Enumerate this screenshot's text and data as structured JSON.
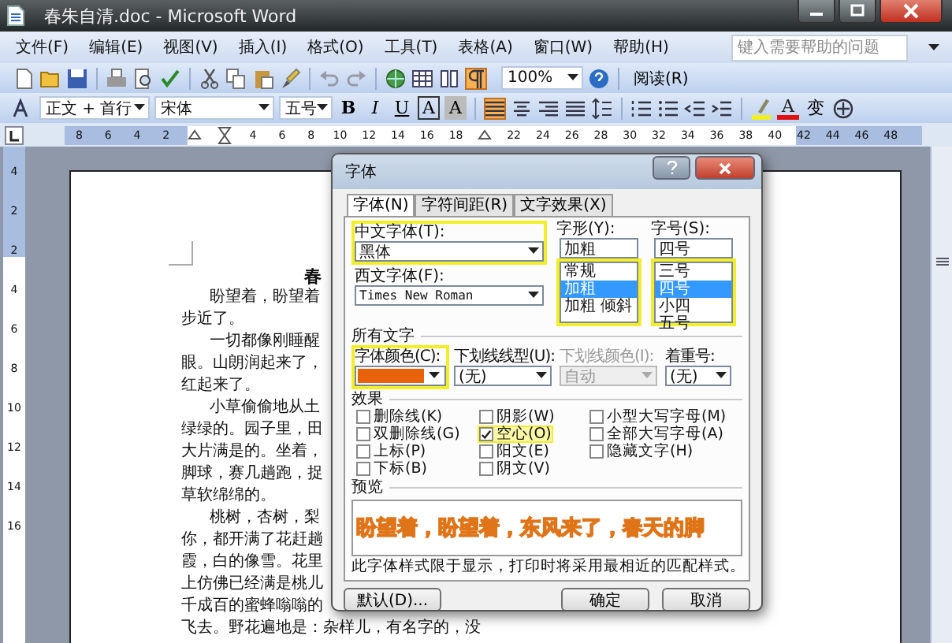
{
  "window": {
    "title": "春朱自清.doc - Microsoft Word"
  },
  "menu_bar": {
    "items": [
      "文件(F)",
      "编辑(E)",
      "视图(V)",
      "插入(I)",
      "格式(O)",
      "工具(T)",
      "表格(A)",
      "窗口(W)",
      "帮助(H)"
    ],
    "help_search": {
      "placeholder": "键入需要帮助的问题"
    }
  },
  "standard_toolbar": {
    "formatting_marks": {
      "on": true
    },
    "zoom": "100%",
    "read_button": "阅读(R)"
  },
  "formatting_toolbar": {
    "style": "正文 + 首行",
    "font": "宋体",
    "size": "五号",
    "format_buttons": [
      {
        "label": "B",
        "kind": "bold"
      },
      {
        "label": "I",
        "kind": "italic"
      },
      {
        "label": "U",
        "kind": "underline"
      },
      {
        "label": "A",
        "kind": "border"
      },
      {
        "label": "A",
        "kind": "shading"
      }
    ],
    "alignment": [
      {
        "kind": "justify",
        "selected": true
      },
      {
        "kind": "center",
        "selected": false
      },
      {
        "kind": "right",
        "selected": false
      },
      {
        "kind": "distributed",
        "selected": false
      }
    ],
    "font_color": {
      "label": "A",
      "color": "#e01010"
    },
    "phonetic_guide": "变"
  },
  "ruler": {
    "marks": [
      {
        "kind": "number",
        "label": "8"
      },
      {
        "kind": "number",
        "label": "6"
      },
      {
        "kind": "number",
        "label": "4"
      },
      {
        "kind": "number",
        "label": "2"
      },
      {
        "kind": "hanging_indent"
      },
      {
        "kind": "first_line_indent"
      },
      {
        "kind": "number",
        "label": "4"
      },
      {
        "kind": "number",
        "label": "6"
      },
      {
        "kind": "number",
        "label": "8"
      },
      {
        "kind": "number",
        "label": "10"
      },
      {
        "kind": "number",
        "label": "12"
      },
      {
        "kind": "number",
        "label": "14"
      },
      {
        "kind": "number",
        "label": "16"
      },
      {
        "kind": "number",
        "label": "18"
      },
      {
        "kind": "right_indent"
      },
      {
        "kind": "number",
        "label": "22"
      },
      {
        "kind": "number",
        "label": "24"
      },
      {
        "kind": "number",
        "label": "26"
      },
      {
        "kind": "number",
        "label": "28"
      },
      {
        "kind": "number",
        "label": "30"
      },
      {
        "kind": "number",
        "label": "32"
      },
      {
        "kind": "number",
        "label": "34"
      },
      {
        "kind": "number",
        "label": "36"
      },
      {
        "kind": "number",
        "label": "38"
      },
      {
        "kind": "number",
        "label": "40"
      },
      {
        "kind": "number",
        "label": "42"
      },
      {
        "kind": "number",
        "label": "44"
      },
      {
        "kind": "number",
        "label": "46"
      },
      {
        "kind": "number",
        "label": "48"
      }
    ],
    "vertical_labels": [
      "4",
      "2",
      "2",
      "4",
      "6",
      "8",
      "10",
      "12",
      "14",
      "16"
    ]
  },
  "document": {
    "title": "春",
    "lines": [
      {
        "text": "盼望着，盼望着",
        "kind": "paragraph_start"
      },
      {
        "text": "步近了。",
        "kind": "continuation"
      },
      {
        "text": "一切都像刚睡醒",
        "kind": "paragraph_start"
      },
      {
        "text": "眼。山朗润起来了，",
        "kind": "continuation"
      },
      {
        "text": "红起来了。",
        "kind": "continuation"
      },
      {
        "text": "小草偷偷地从土",
        "kind": "paragraph_start"
      },
      {
        "text": "绿绿的。园子里，田",
        "kind": "continuation"
      },
      {
        "text": "大片满是的。坐着，",
        "kind": "continuation"
      },
      {
        "text": "脚球，赛几趟跑，捉",
        "kind": "continuation"
      },
      {
        "text": "草软绵绵的。",
        "kind": "continuation"
      },
      {
        "text": "桃树，杏树，梨",
        "kind": "paragraph_start"
      },
      {
        "text": "你，都开满了花赶趟",
        "kind": "continuation"
      },
      {
        "text": "霞，白的像雪。花里",
        "kind": "continuation"
      },
      {
        "text": "上仿佛已经满是桃儿",
        "kind": "continuation"
      },
      {
        "text": "千成百的蜜蜂嗡嗡的",
        "kind": "continuation"
      },
      {
        "text": "飞去。野花遍地是：杂样儿，有名字的，没",
        "kind": "continuation"
      }
    ]
  },
  "font_dialog": {
    "title": "字体",
    "tabs": [
      {
        "label": "字体(N)",
        "selected": true
      },
      {
        "label": "字符间距(R)",
        "selected": false
      },
      {
        "label": "文字效果(X)",
        "selected": false
      }
    ],
    "chinese_font": {
      "label": "中文字体(T):",
      "value": "黑体",
      "highlighted": true
    },
    "western_font": {
      "label": "西文字体(F):",
      "value": "Times New Roman"
    },
    "font_style": {
      "label": "字形(Y):",
      "value": "加粗",
      "highlighted": true,
      "options": [
        {
          "label": "常规",
          "selected": false
        },
        {
          "label": "加粗",
          "selected": true
        },
        {
          "label": "加粗 倾斜",
          "selected": false
        }
      ]
    },
    "font_size": {
      "label": "字号(S):",
      "value": "四号",
      "highlighted": true,
      "options": [
        {
          "label": "三号",
          "selected": false
        },
        {
          "label": "四号",
          "selected": true
        },
        {
          "label": "小四",
          "selected": false
        },
        {
          "label": "五号",
          "selected": false
        }
      ]
    },
    "all_text": {
      "title": "所有文字",
      "font_color": {
        "label": "字体颜色(C):",
        "color": "#e8620c",
        "highlighted": true
      },
      "underline_style": {
        "label": "下划线线型(U):",
        "value": "(无)",
        "disabled": false
      },
      "underline_color": {
        "label": "下划线颜色(I):",
        "value": "自动",
        "disabled": true
      },
      "emphasis": {
        "label": "着重号:",
        "value": "(无)",
        "disabled": false
      }
    },
    "effects": {
      "title": "效果",
      "options": [
        {
          "label": "删除线(K)",
          "checked": false,
          "highlighted": false
        },
        {
          "label": "双删除线(G)",
          "checked": false,
          "highlighted": false
        },
        {
          "label": "上标(P)",
          "checked": false,
          "highlighted": false
        },
        {
          "label": "下标(B)",
          "checked": false,
          "highlighted": false
        },
        {
          "label": "阴影(W)",
          "checked": false,
          "highlighted": false
        },
        {
          "label": "空心(O)",
          "checked": true,
          "highlighted": true
        },
        {
          "label": "阳文(E)",
          "checked": false,
          "highlighted": false
        },
        {
          "label": "阴文(V)",
          "checked": false,
          "highlighted": false
        },
        {
          "label": "小型大写字母(M)",
          "checked": false,
          "highlighted": false
        },
        {
          "label": "全部大写字母(A)",
          "checked": false,
          "highlighted": false
        },
        {
          "label": "隐藏文字(H)",
          "checked": false,
          "highlighted": false
        }
      ]
    },
    "preview": {
      "title": "预览",
      "sample": "盼望着，盼望着，东风来了，春天的脚"
    },
    "note": "此字体样式限于显示，打印时将采用最相近的匹配样式。",
    "buttons": [
      {
        "label": "默认(D)...",
        "kind": "default"
      },
      {
        "label": "确定",
        "kind": "ok"
      },
      {
        "label": "取消",
        "kind": "cancel"
      }
    ]
  }
}
